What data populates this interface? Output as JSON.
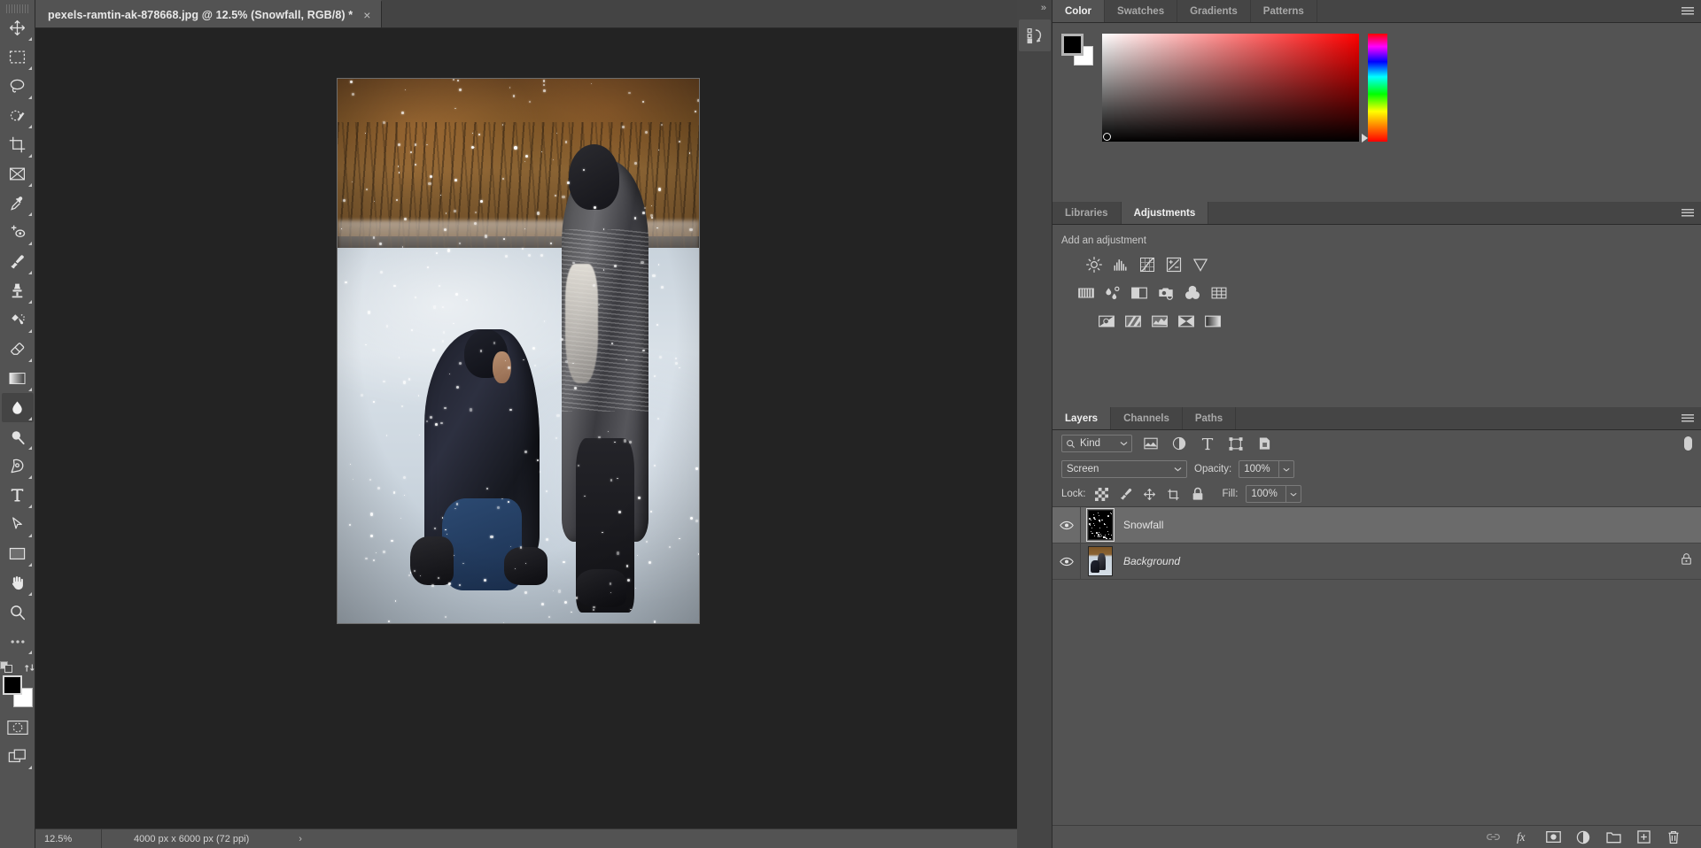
{
  "document": {
    "tab_title": "pexels-ramtin-ak-878668.jpg @ 12.5% (Snowfall, RGB/8) *",
    "close_glyph": "×"
  },
  "status": {
    "zoom": "12.5%",
    "dimensions": "4000 px x 6000 px (72 ppi)",
    "arrow": "›"
  },
  "toolbar": {
    "tools": [
      {
        "name": "move-tool",
        "label": "Move"
      },
      {
        "name": "rectangular-marquee-tool",
        "label": "Rectangular Marquee"
      },
      {
        "name": "lasso-tool",
        "label": "Lasso"
      },
      {
        "name": "quick-selection-tool",
        "label": "Object Selection"
      },
      {
        "name": "crop-tool",
        "label": "Crop"
      },
      {
        "name": "frame-tool",
        "label": "Frame"
      },
      {
        "name": "eyedropper-tool",
        "label": "Eyedropper"
      },
      {
        "name": "spot-healing-brush-tool",
        "label": "Spot Healing Brush"
      },
      {
        "name": "brush-tool",
        "label": "Brush"
      },
      {
        "name": "clone-stamp-tool",
        "label": "Clone Stamp"
      },
      {
        "name": "history-brush-tool",
        "label": "History Brush"
      },
      {
        "name": "eraser-tool",
        "label": "Eraser"
      },
      {
        "name": "gradient-tool",
        "label": "Gradient"
      },
      {
        "name": "blur-tool",
        "label": "Blur"
      },
      {
        "name": "dodge-tool",
        "label": "Dodge"
      },
      {
        "name": "pen-tool",
        "label": "Pen"
      },
      {
        "name": "type-tool",
        "label": "Horizontal Type"
      },
      {
        "name": "path-selection-tool",
        "label": "Path Selection"
      },
      {
        "name": "rectangle-tool",
        "label": "Rectangle"
      },
      {
        "name": "hand-tool",
        "label": "Hand"
      },
      {
        "name": "zoom-tool",
        "label": "Zoom"
      }
    ],
    "active_tool": "blur-tool",
    "more_tools_label": "•••",
    "foreground_color": "#000000",
    "background_color": "#ffffff"
  },
  "color_panel": {
    "tabs": [
      {
        "label": "Color",
        "selected": true
      },
      {
        "label": "Swatches",
        "selected": false
      },
      {
        "label": "Gradients",
        "selected": false
      },
      {
        "label": "Patterns",
        "selected": false
      }
    ],
    "foreground": "#000000",
    "background": "#ffffff",
    "hue_base": "#ff0000"
  },
  "adjustments_panel": {
    "tabs": [
      {
        "label": "Libraries",
        "selected": false
      },
      {
        "label": "Adjustments",
        "selected": true
      }
    ],
    "heading": "Add an adjustment",
    "row1": [
      {
        "name": "brightness-contrast-icon",
        "label": "Brightness/Contrast"
      },
      {
        "name": "levels-icon",
        "label": "Levels"
      },
      {
        "name": "curves-icon",
        "label": "Curves"
      },
      {
        "name": "exposure-icon",
        "label": "Exposure"
      },
      {
        "name": "vibrance-icon",
        "label": "Vibrance"
      }
    ],
    "row2": [
      {
        "name": "hue-saturation-icon",
        "label": "Hue/Saturation"
      },
      {
        "name": "color-balance-icon",
        "label": "Color Balance"
      },
      {
        "name": "black-white-icon",
        "label": "Black & White"
      },
      {
        "name": "photo-filter-icon",
        "label": "Photo Filter"
      },
      {
        "name": "channel-mixer-icon",
        "label": "Channel Mixer"
      },
      {
        "name": "color-lookup-icon",
        "label": "Color Lookup"
      }
    ],
    "row3": [
      {
        "name": "invert-icon",
        "label": "Invert"
      },
      {
        "name": "posterize-icon",
        "label": "Posterize"
      },
      {
        "name": "threshold-icon",
        "label": "Threshold"
      },
      {
        "name": "gradient-map-icon",
        "label": "Gradient Map"
      },
      {
        "name": "selective-color-icon",
        "label": "Selective Color"
      }
    ]
  },
  "layers_panel": {
    "tabs": [
      {
        "label": "Layers",
        "selected": true
      },
      {
        "label": "Channels",
        "selected": false
      },
      {
        "label": "Paths",
        "selected": false
      }
    ],
    "filter_kind": "Kind",
    "filter_icons": [
      {
        "name": "filter-pixel-icon",
        "label": "Pixel layers"
      },
      {
        "name": "filter-adjustment-icon",
        "label": "Adjustment layers"
      },
      {
        "name": "filter-type-icon",
        "label": "Type layers"
      },
      {
        "name": "filter-shape-icon",
        "label": "Shape layers"
      },
      {
        "name": "filter-smart-object-icon",
        "label": "Smart objects"
      }
    ],
    "blend_mode": "Screen",
    "opacity_label": "Opacity:",
    "opacity_value": "100%",
    "lock_label": "Lock:",
    "fill_label": "Fill:",
    "fill_value": "100%",
    "lock_icons": [
      {
        "name": "lock-transparent-pixels-icon",
        "label": "Lock transparent pixels"
      },
      {
        "name": "lock-image-pixels-icon",
        "label": "Lock image pixels"
      },
      {
        "name": "lock-position-icon",
        "label": "Lock position"
      },
      {
        "name": "lock-artboard-icon",
        "label": "Prevent auto-nesting"
      },
      {
        "name": "lock-all-icon",
        "label": "Lock all"
      }
    ],
    "layers": [
      {
        "name": "Snowfall",
        "selected": true,
        "visible": true,
        "locked": false,
        "italic": false
      },
      {
        "name": "Background",
        "selected": false,
        "visible": true,
        "locked": true,
        "italic": true
      }
    ],
    "actions": [
      {
        "name": "link-layers-icon",
        "label": "Link layers"
      },
      {
        "name": "layer-style-icon",
        "label": "Add a layer style"
      },
      {
        "name": "add-mask-icon",
        "label": "Add layer mask"
      },
      {
        "name": "new-adjustment-layer-icon",
        "label": "New fill or adjustment layer"
      },
      {
        "name": "new-group-icon",
        "label": "Create a new group"
      },
      {
        "name": "new-layer-icon",
        "label": "Create a new layer"
      },
      {
        "name": "delete-layer-icon",
        "label": "Delete layer"
      }
    ]
  }
}
